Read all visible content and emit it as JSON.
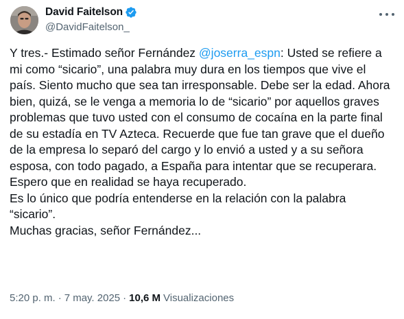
{
  "author": {
    "display_name": "David Faitelson",
    "handle": "@DavidFaitelson_",
    "verified": true,
    "verified_color": "#1d9bf0"
  },
  "tweet": {
    "text_before_mention": "Y tres.- Estimado señor Fernández ",
    "mention": "@joserra_espn",
    "text_after_mention": ": Usted se refiere a mi como “sicario”, una palabra muy dura en los tiempos que vive el país. Siento mucho que sea tan irresponsable. Debe ser la edad. Ahora bien, quizá, se le venga a memoria lo de “sicario” por aquellos graves problemas que tuvo usted con el consumo de cocaína en la parte final de su estadía en TV Azteca. Recuerde que fue tan grave que el dueño de la empresa lo separó del cargo y lo envió a usted y a su señora esposa, con todo pagado, a España para intentar que se recuperara. Espero que en realidad se haya recuperado.\nEs lo único que podría entenderse en la relación con la palabra “sicario”.\nMuchas gracias, señor Fernández...",
    "mention_color": "#1d9bf0"
  },
  "meta": {
    "time": "5:20 p. m.",
    "separator": "·",
    "date": "7 may. 2025",
    "views_count": "10,6 M",
    "views_label": "Visualizaciones"
  },
  "icons": {
    "verified": "verified-badge-icon",
    "more": "more-options-icon"
  }
}
